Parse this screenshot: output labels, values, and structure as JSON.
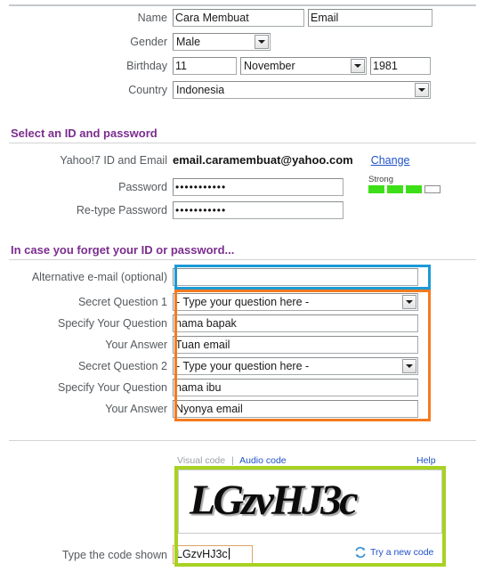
{
  "form": {
    "rows": [
      {
        "label": "Name",
        "first_name": "Cara Membuat",
        "last_name": "Email"
      },
      {
        "label": "Gender",
        "value": "Male"
      },
      {
        "label": "Birthday",
        "day": "11",
        "month": "November",
        "year": "1981"
      },
      {
        "label": "Country",
        "value": "Indonesia"
      }
    ]
  },
  "section_id": {
    "title": "Select an ID and password",
    "id_label": "Yahoo!7 ID and Email",
    "id_value": "email.caramembuat@yahoo.com",
    "change_link": "Change",
    "password_label": "Password",
    "password_value": "•••••••••••",
    "retype_label": "Re-type Password",
    "retype_value": "•••••••••••",
    "strength_text": "Strong",
    "strength_filled": 3,
    "strength_total": 4,
    "strength_color": "#3ddf18"
  },
  "section_forgot": {
    "title": "In case you forget your ID or password...",
    "alt_email_label": "Alternative e-mail (optional)",
    "alt_email_value": "",
    "q1_label": "Secret Question 1",
    "q1_value": "- Type your question here -",
    "q1_specify_label": "Specify Your Question",
    "q1_specify_value": "nama bapak",
    "q1_answer_label": "Your Answer",
    "q1_answer_value": "Tuan email",
    "q2_label": "Secret Question 2",
    "q2_value": "- Type your question here -",
    "q2_specify_label": "Specify Your Question",
    "q2_specify_value": "nama ibu",
    "q2_answer_label": "Your Answer",
    "q2_answer_value": "Nyonya email",
    "highlight_blue": "#1b9ad6",
    "highlight_orange": "#f47b20"
  },
  "captcha": {
    "visual_code_link": "Visual code",
    "audio_code_link": "Audio code",
    "help_link": "Help",
    "image_text": "LGzvHJ3c",
    "type_code_label": "Type the code shown",
    "code_value": "LGzvHJ3c",
    "try_new_label": "Try a new code",
    "refresh_icon": "refresh-icon",
    "highlight_green": "#a8d222"
  }
}
